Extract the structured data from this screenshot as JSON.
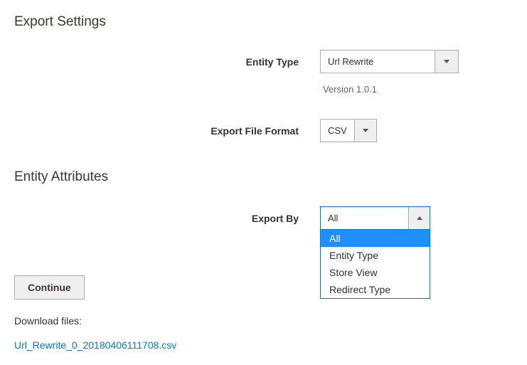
{
  "sections": {
    "export_settings_title": "Export Settings",
    "entity_attributes_title": "Entity Attributes"
  },
  "fields": {
    "entity_type": {
      "label": "Entity Type",
      "value": "Url Rewrite"
    },
    "version_text": "Version 1.0.1",
    "export_file_format": {
      "label": "Export File Format",
      "value": "CSV"
    },
    "export_by": {
      "label": "Export By",
      "value": "All",
      "options": [
        "All",
        "Entity Type",
        "Store View",
        "Redirect Type"
      ]
    }
  },
  "buttons": {
    "continue": "Continue"
  },
  "download": {
    "label": "Download files:",
    "file": "Url_Rewrite_0_20180406111708.csv"
  }
}
